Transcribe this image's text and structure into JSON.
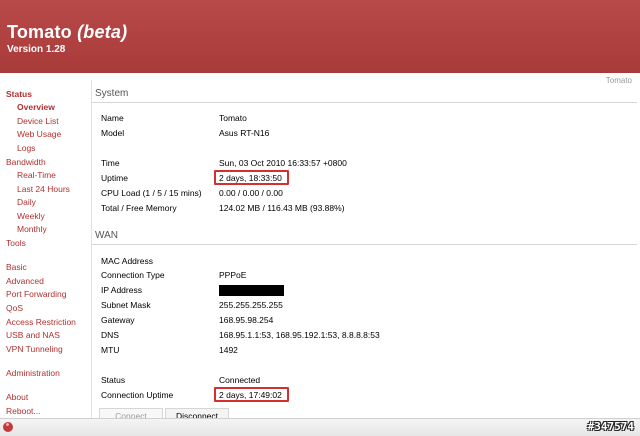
{
  "brand": {
    "name": "Tomato",
    "beta": "(beta)",
    "version": "Version 1.28"
  },
  "corner_label": "Tomato",
  "sidebar": {
    "status": "Status",
    "overview": "Overview",
    "device_list": "Device List",
    "web_usage": "Web Usage",
    "logs": "Logs",
    "bandwidth": "Bandwidth",
    "real_time": "Real-Time",
    "last_24": "Last 24 Hours",
    "daily": "Daily",
    "weekly": "Weekly",
    "monthly": "Monthly",
    "tools": "Tools",
    "basic": "Basic",
    "advanced": "Advanced",
    "port_forwarding": "Port Forwarding",
    "qos": "QoS",
    "access_restriction": "Access Restriction",
    "usb_nas": "USB and NAS",
    "vpn": "VPN Tunneling",
    "administration": "Administration",
    "about": "About",
    "reboot": "Reboot..."
  },
  "system": {
    "title": "System",
    "name_label": "Name",
    "name_value": "Tomato",
    "model_label": "Model",
    "model_value": "Asus RT-N16",
    "time_label": "Time",
    "time_value": "Sun, 03 Oct 2010 16:33:57 +0800",
    "uptime_label": "Uptime",
    "uptime_value": "2 days, 18:33:50",
    "cpu_label": "CPU Load (1 / 5 / 15 mins)",
    "cpu_value": "0.00 / 0.00 / 0.00",
    "memory_label": "Total / Free Memory",
    "memory_value": "124.02 MB / 116.43 MB (93.88%)"
  },
  "wan": {
    "title": "WAN",
    "mac_label": "MAC Address",
    "conn_type_label": "Connection Type",
    "conn_type_value": "PPPoE",
    "ip_label": "IP Address",
    "subnet_label": "Subnet Mask",
    "subnet_value": "255.255.255.255",
    "gateway_label": "Gateway",
    "gateway_value": "168.95.98.254",
    "dns_label": "DNS",
    "dns_value": "168.95.1.1:53, 168.95.192.1:53, 8.8.8.8:53",
    "mtu_label": "MTU",
    "mtu_value": "1492",
    "status_label": "Status",
    "status_value": "Connected",
    "conn_uptime_label": "Connection Uptime",
    "conn_uptime_value": "2 days, 17:49:02",
    "connect_button": "Connect",
    "disconnect_button": "Disconnect"
  },
  "watermark": "#347574",
  "colors": {
    "header_bg": "#b04040",
    "nav_link": "#b03030",
    "highlight_box": "#d43030"
  }
}
